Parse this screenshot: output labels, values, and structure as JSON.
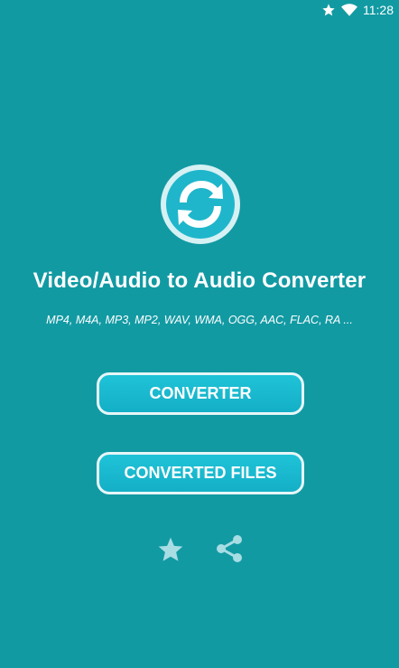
{
  "status_bar": {
    "time": "11:28"
  },
  "app": {
    "title": "Video/Audio to Audio Converter",
    "formats": "MP4, M4A, MP3, MP2, WAV, WMA, OGG, AAC, FLAC, RA ..."
  },
  "buttons": {
    "converter": "CONVERTER",
    "converted_files": "CONVERTED FILES"
  },
  "icons": {
    "status_star": "star-icon",
    "status_wifi": "wifi-icon",
    "logo": "convert-arrows-icon",
    "rate": "star-icon",
    "share": "share-icon"
  },
  "colors": {
    "background": "#129aa3",
    "button_fill": "#1bbcd2",
    "button_border": "#e6f6f8",
    "icon_light": "#a8dde4"
  }
}
